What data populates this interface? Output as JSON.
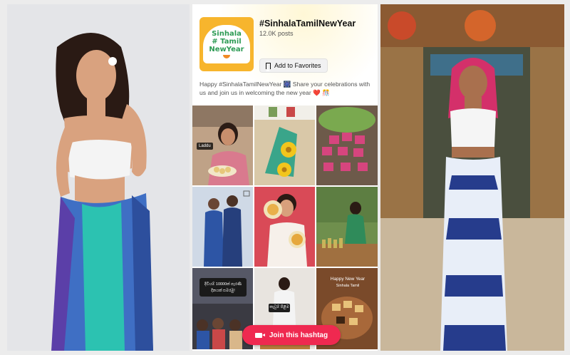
{
  "hashtag": {
    "title": "#SinhalaTamilNewYear",
    "count": "12.0K posts",
    "favorite_label": "Add to Favorites",
    "description": "Happy #SinhalaTamilNewYear 🎆 Share your celebrations with us and join us in welcoming the new year ❤️ 🎊"
  },
  "logo": {
    "line1": "Sinhala",
    "line2": "Tamil",
    "line3": "NewYear",
    "hash": "#"
  },
  "tiles": {
    "t1_label": "Laddu",
    "t7_text1": "දිවියම් 10000ක් පැරණි",
    "t7_text2": "දිනයක් සමරමු!",
    "t8_text": "කැවුම් පිළිම",
    "t9_text1": "Happy New Year",
    "t9_text2": "Sinhala Tamil"
  },
  "join_label": "Join this hashtag",
  "colors": {
    "accent": "#ef2950",
    "logo_bg": "#f7b52d",
    "logo_text": "#2e9b55"
  }
}
